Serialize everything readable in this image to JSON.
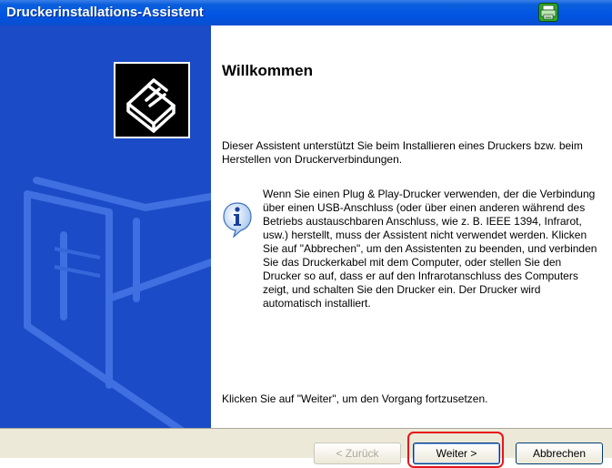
{
  "window": {
    "title": "Druckerinstallations-Assistent"
  },
  "content": {
    "heading": "Willkommen",
    "intro": "Dieser Assistent unterstützt Sie beim Installieren eines Druckers bzw. beim Herstellen von Druckerverbindungen.",
    "note": "Wenn Sie einen Plug & Play-Drucker verwenden, der die Verbindung über einen USB-Anschluss (oder über einen anderen während des Betriebs austauschbaren Anschluss, wie z. B. IEEE 1394, Infrarot, usw.) herstellt, muss der Assistent nicht verwendet werden. Klicken Sie auf \"Abbrechen\", um den Assistenten zu beenden, und verbinden Sie das Druckerkabel mit dem Computer, oder stellen Sie den Drucker so auf, dass er auf den Infrarotanschluss des Computers zeigt, und schalten Sie den Drucker ein. Der Drucker wird automatisch installiert.",
    "continue_hint": "Klicken Sie auf \"Weiter\", um den Vorgang fortzusetzen."
  },
  "buttons": {
    "back": {
      "label": "< Zurück",
      "enabled": false
    },
    "next": {
      "label": "Weiter >",
      "enabled": true,
      "highlighted": true
    },
    "cancel": {
      "label": "Abbrechen",
      "enabled": true
    }
  },
  "icons": {
    "title_icon": "printer-window-icon",
    "wizard_icon": "printer-wizard-icon",
    "info_icon": "info-icon"
  },
  "colors": {
    "titlebar": "#0054e3",
    "sidebar": "#1b4bc6",
    "highlight": "#e8141a",
    "face": "#ece9d8"
  }
}
